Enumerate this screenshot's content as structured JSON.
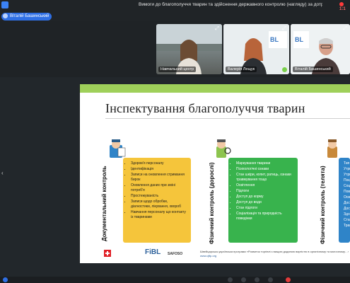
{
  "window": {
    "meeting_title": "Вимоги до благополуччя тварин та здійснення державного контролю (нагляду) за дотрима…",
    "recording_time": "1:1",
    "presenter_name": "Віталій Башинський"
  },
  "participants": [
    {
      "name": "Навчальний центр"
    },
    {
      "name": "Валерія Лещук"
    },
    {
      "name": "Віталій Башинський"
    }
  ],
  "slide": {
    "title": "Інспектування благополуччя тварин",
    "columns": [
      {
        "label": "Документальний контроль",
        "items": [
          "Здоров'я персоналу",
          "Ідентифікація",
          "Записи на оновлення стримання бирок",
          "Оновлення даних при зміні потреб'я",
          "Простежуваність",
          "Записи щодо обробки, діагностики, лікування, хвороб",
          "Навчання персоналу що контакту із тваринами"
        ]
      },
      {
        "label": "Фізичний контроль (дорослі)",
        "items": [
          "Маркування тварини",
          "Психологічні ознаки",
          "Стан шкіри, копит, ратиць, ознаки травмування тощо",
          "Освітлення",
          "Підлоги",
          "Доступ до корму",
          "Доступ до води",
          "Стан підлоги",
          "Соціалізація та природність поведінки"
        ]
      },
      {
        "label": "Фізичний контроль (телята)",
        "items": [
          "Тип п",
          "Утрим",
          "Утрим",
          "Поєдн",
          "Соціа",
          "Повіт",
          "Освіт",
          "Досту",
          "Досту",
          "Здоро",
          "Стан",
          "Трави"
        ]
      }
    ],
    "footer": {
      "logo_fibl": "FiBL",
      "logo_safosо": "SAFOSO",
      "note": "Швейцарсько-українська програма «Розвиток торгівлі з вищою доданою вартістю в органічному та молочному…»",
      "note_url": "www.qftp.org"
    }
  },
  "colors": {
    "accent_green": "#9fd05a",
    "yellow_box": "#f5c53b",
    "green_box": "#38b34d",
    "blue_box": "#2f84c8",
    "brand_blue": "#2f6fe4"
  }
}
